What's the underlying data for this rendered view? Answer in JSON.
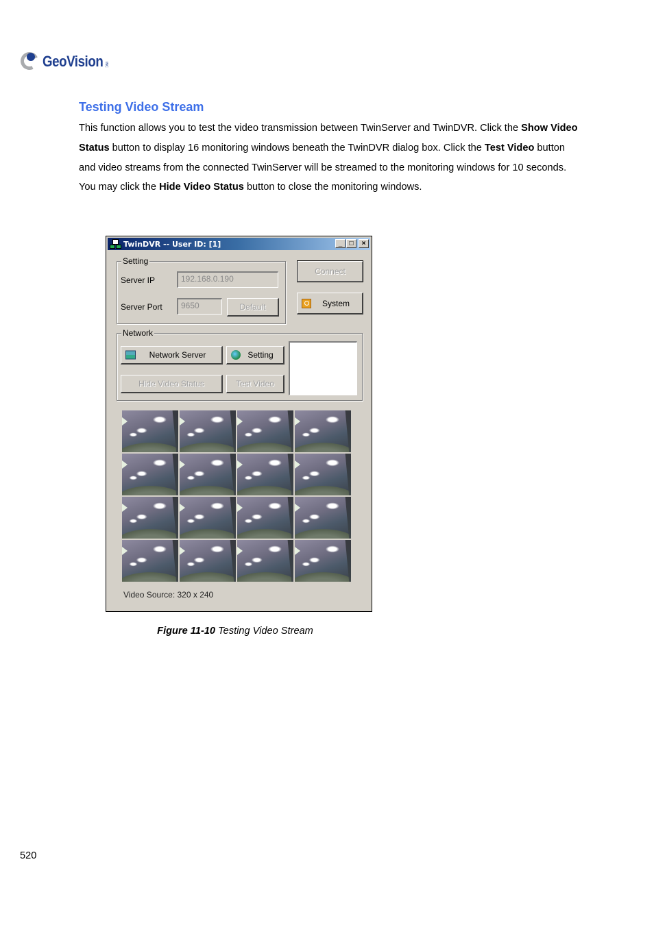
{
  "brand": {
    "name": "GeoVision",
    "suffix": "INC",
    "color": "#1f3f8f"
  },
  "section": {
    "title": "Testing Video Stream",
    "title_color": "#3d6fe8",
    "paragraph": [
      {
        "text": "This function allows you to test the video transmission between TwinServer and TwinDVR. Click the ",
        "bold": false
      },
      {
        "text": "Show Video Status",
        "bold": true
      },
      {
        "text": " button to display 16 monitoring windows beneath the TwinDVR dialog box. Click the ",
        "bold": false
      },
      {
        "text": "Test Video",
        "bold": true
      },
      {
        "text": " button and video streams from the connected TwinServer will be streamed to the monitoring windows for 10 seconds. You may click the ",
        "bold": false
      },
      {
        "text": "Hide Video Status",
        "bold": true
      },
      {
        "text": " button to close the monitoring windows.",
        "bold": false
      }
    ]
  },
  "dialog": {
    "title": "TwinDVR -- User ID: [1]",
    "title_buttons": {
      "minimize": "_",
      "maximize": "□",
      "close": "×"
    },
    "setting_group": {
      "label": "Setting",
      "server_ip_label": "Server IP",
      "server_ip_value": "192.168.0.190",
      "server_port_label": "Server Port",
      "server_port_value": "9650",
      "default_button": "Default"
    },
    "connect_button": "Connect",
    "system_button": "System",
    "network_group": {
      "label": "Network",
      "network_server_button": "Network Server",
      "setting_button": "Setting",
      "hide_video_status_button": "Hide Video Status",
      "test_video_button": "Test Video"
    },
    "monitor_count": 16,
    "video_source_label": "Video Source: 320 x 240"
  },
  "figure_caption": {
    "number": "Figure 11-10",
    "text": " Testing Video Stream"
  },
  "page_number": "520"
}
